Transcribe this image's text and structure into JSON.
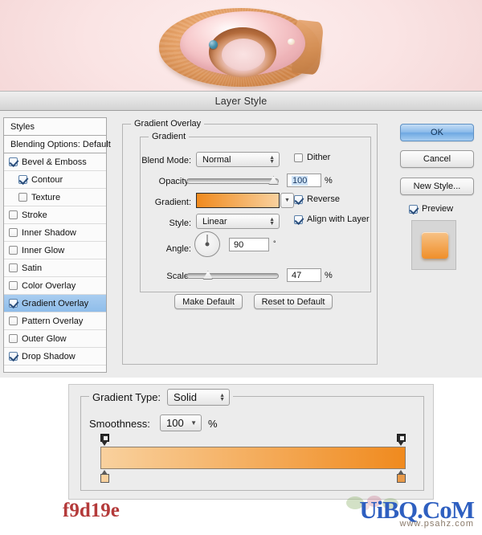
{
  "window": {
    "title": "Layer Style"
  },
  "hero": {
    "alt": "donut-illustration",
    "icon_names": [
      "donut-body",
      "donut-icing",
      "blue-sprinkle",
      "white-sprinkle"
    ]
  },
  "sidebar": {
    "items": [
      {
        "label": "Styles",
        "type": "header",
        "checkbox": null,
        "indent": false,
        "selected": false
      },
      {
        "label": "Blending Options: Default",
        "type": "header",
        "checkbox": null,
        "indent": false,
        "selected": false
      },
      {
        "label": "Bevel & Emboss",
        "type": "effect",
        "checkbox": true,
        "indent": false,
        "selected": false
      },
      {
        "label": "Contour",
        "type": "sub",
        "checkbox": true,
        "indent": true,
        "selected": false
      },
      {
        "label": "Texture",
        "type": "sub",
        "checkbox": false,
        "indent": true,
        "selected": false
      },
      {
        "label": "Stroke",
        "type": "effect",
        "checkbox": false,
        "indent": false,
        "selected": false
      },
      {
        "label": "Inner Shadow",
        "type": "effect",
        "checkbox": false,
        "indent": false,
        "selected": false
      },
      {
        "label": "Inner Glow",
        "type": "effect",
        "checkbox": false,
        "indent": false,
        "selected": false
      },
      {
        "label": "Satin",
        "type": "effect",
        "checkbox": false,
        "indent": false,
        "selected": false
      },
      {
        "label": "Color Overlay",
        "type": "effect",
        "checkbox": false,
        "indent": false,
        "selected": false
      },
      {
        "label": "Gradient Overlay",
        "type": "effect",
        "checkbox": true,
        "indent": false,
        "selected": true
      },
      {
        "label": "Pattern Overlay",
        "type": "effect",
        "checkbox": false,
        "indent": false,
        "selected": false
      },
      {
        "label": "Outer Glow",
        "type": "effect",
        "checkbox": false,
        "indent": false,
        "selected": false
      },
      {
        "label": "Drop Shadow",
        "type": "effect",
        "checkbox": true,
        "indent": false,
        "selected": false
      }
    ]
  },
  "panel": {
    "section_title": "Gradient Overlay",
    "group_title": "Gradient",
    "blend_mode": {
      "label": "Blend Mode:",
      "value": "Normal"
    },
    "dither": {
      "label": "Dither",
      "checked": false
    },
    "opacity": {
      "label": "Opacity:",
      "value": "100",
      "unit": "%",
      "slider_pct": 100
    },
    "gradient": {
      "label": "Gradient:",
      "start_color": "#f08a1e",
      "end_color": "#f9d19e"
    },
    "reverse": {
      "label": "Reverse",
      "checked": true
    },
    "style": {
      "label": "Style:",
      "value": "Linear"
    },
    "align_with_layer": {
      "label": "Align with Layer",
      "checked": true
    },
    "angle": {
      "label": "Angle:",
      "value": "90",
      "unit": "°"
    },
    "scale": {
      "label": "Scale:",
      "value": "47",
      "unit": "%",
      "slider_pct": 23
    },
    "make_default": "Make Default",
    "reset_to_default": "Reset to Default"
  },
  "buttons": {
    "ok": "OK",
    "cancel": "Cancel",
    "new_style": "New Style...",
    "preview": {
      "label": "Preview",
      "checked": true
    },
    "preview_chip_color": "#ef8f2a"
  },
  "gradient_editor": {
    "gradient_type": {
      "label": "Gradient Type:",
      "value": "Solid"
    },
    "smoothness": {
      "label": "Smoothness:",
      "value": "100",
      "unit": "%"
    },
    "bar": {
      "left_color": "#f9d19e",
      "right_color": "#f08a1e",
      "opacity_stops": [
        {
          "position_pct": 0,
          "name": "opacity-stop-left"
        },
        {
          "position_pct": 100,
          "name": "opacity-stop-right"
        }
      ],
      "color_stops": [
        {
          "position_pct": 0,
          "color": "#f9d19e",
          "name": "color-stop-left"
        },
        {
          "position_pct": 100,
          "color": "#f08a1e",
          "name": "color-stop-right"
        }
      ]
    }
  },
  "footer": {
    "hex_code": "f9d19e",
    "watermark_main": "UiBQ.CoM",
    "watermark_sub": "www.psahz.com",
    "accent_red": "#b43a3a",
    "accent_blue": "#2e5fc0"
  }
}
